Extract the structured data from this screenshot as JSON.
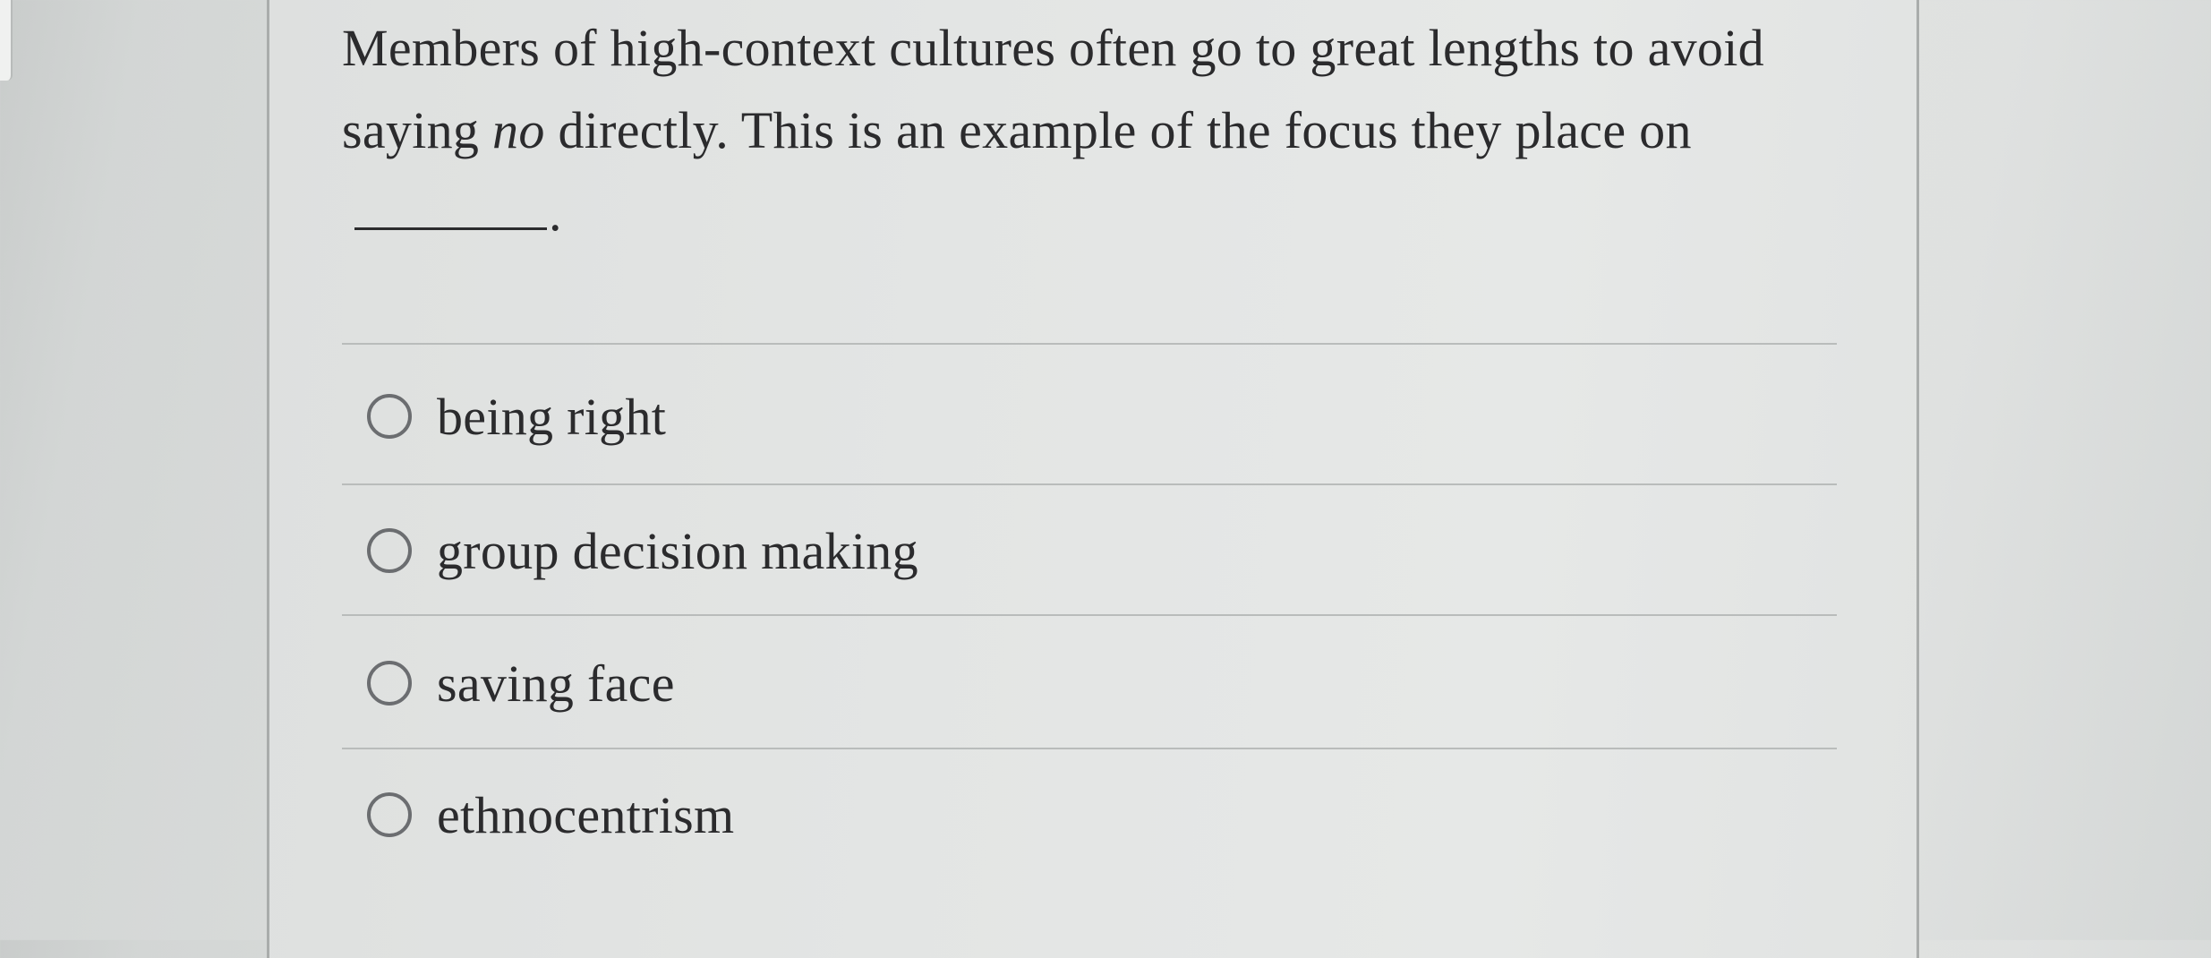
{
  "question": {
    "text_before": "Members of high-context cultures often go to great lengths to avoid saying ",
    "emphasis": "no",
    "text_after": " directly. This is an example of the focus they place on",
    "blank_suffix": "."
  },
  "options": [
    {
      "label": "being right",
      "selected": false
    },
    {
      "label": "group decision making",
      "selected": false
    },
    {
      "label": "saving face",
      "selected": false
    },
    {
      "label": "ethnocentrism",
      "selected": false
    }
  ]
}
